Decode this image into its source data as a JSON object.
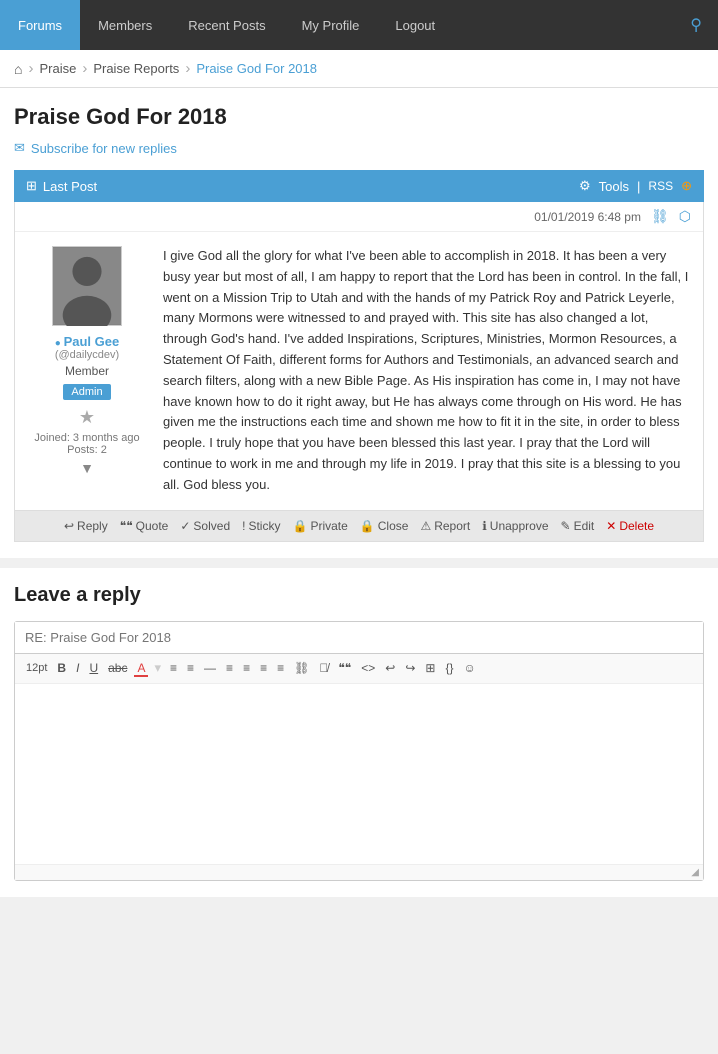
{
  "nav": {
    "items": [
      {
        "label": "Forums",
        "active": true
      },
      {
        "label": "Members",
        "active": false
      },
      {
        "label": "Recent Posts",
        "active": false
      },
      {
        "label": "My Profile",
        "active": false
      },
      {
        "label": "Logout",
        "active": false
      }
    ]
  },
  "breadcrumb": {
    "home": "🏠",
    "items": [
      "Praise",
      "Praise Reports",
      "Praise God For 2018"
    ]
  },
  "page": {
    "title": "Praise God For 2018",
    "subscribe_label": "Subscribe for new replies"
  },
  "toolbar": {
    "last_post_label": "Last Post",
    "tools_label": "Tools",
    "rss_label": "RSS"
  },
  "post": {
    "datetime": "01/01/2019 6:48 pm",
    "author": {
      "name": "Paul Gee",
      "handle": "(@dailycdev)",
      "role": "Member",
      "badge": "Admin",
      "joined": "Joined: 3 months ago",
      "posts": "Posts: 2"
    },
    "content": "I give God all the glory for what I've been able to accomplish in 2018.  It has been a very busy year but most of all, I am happy to report that the Lord has been in control.  In the fall, I went on a Mission Trip to Utah and with the hands of my Patrick Roy and Patrick Leyerle, many Mormons were witnessed to and prayed with.  This site has also changed a lot, through God's hand.  I've added Inspirations, Scriptures, Ministries, Mormon Resources, a Statement Of Faith, different forms for Authors and Testimonials, an advanced search and search filters, along with a new Bible Page.  As His inspiration has come in, I may not have have known how to do it right away, but He has always come through on His word.  He has given me the  instructions each time and shown me how to fit it in the site, in order to bless people.  I truly hope that you have been blessed this last year.  I pray that the Lord will continue to work in me and through my life in 2019.  I pray that this site is a blessing to you all.  God bless you."
  },
  "actions": [
    {
      "label": "Reply",
      "icon": "↩"
    },
    {
      "label": "Quote",
      "icon": "❝❝"
    },
    {
      "label": "Solved",
      "icon": "✓"
    },
    {
      "label": "Sticky",
      "icon": "!"
    },
    {
      "label": "Private",
      "icon": "🔒"
    },
    {
      "label": "Close",
      "icon": "🔒"
    },
    {
      "label": "Report",
      "icon": "⚠"
    },
    {
      "label": "Unapprove",
      "icon": "ℹ"
    },
    {
      "label": "Edit",
      "icon": "✎"
    },
    {
      "label": "Delete",
      "icon": "✕"
    }
  ],
  "reply": {
    "title": "Leave a reply",
    "subject_placeholder": "RE: Praise God For 2018",
    "toolbar": {
      "font_size": "12pt",
      "bold": "B",
      "italic": "I",
      "underline": "U",
      "strike": "abc",
      "color": "A"
    }
  }
}
